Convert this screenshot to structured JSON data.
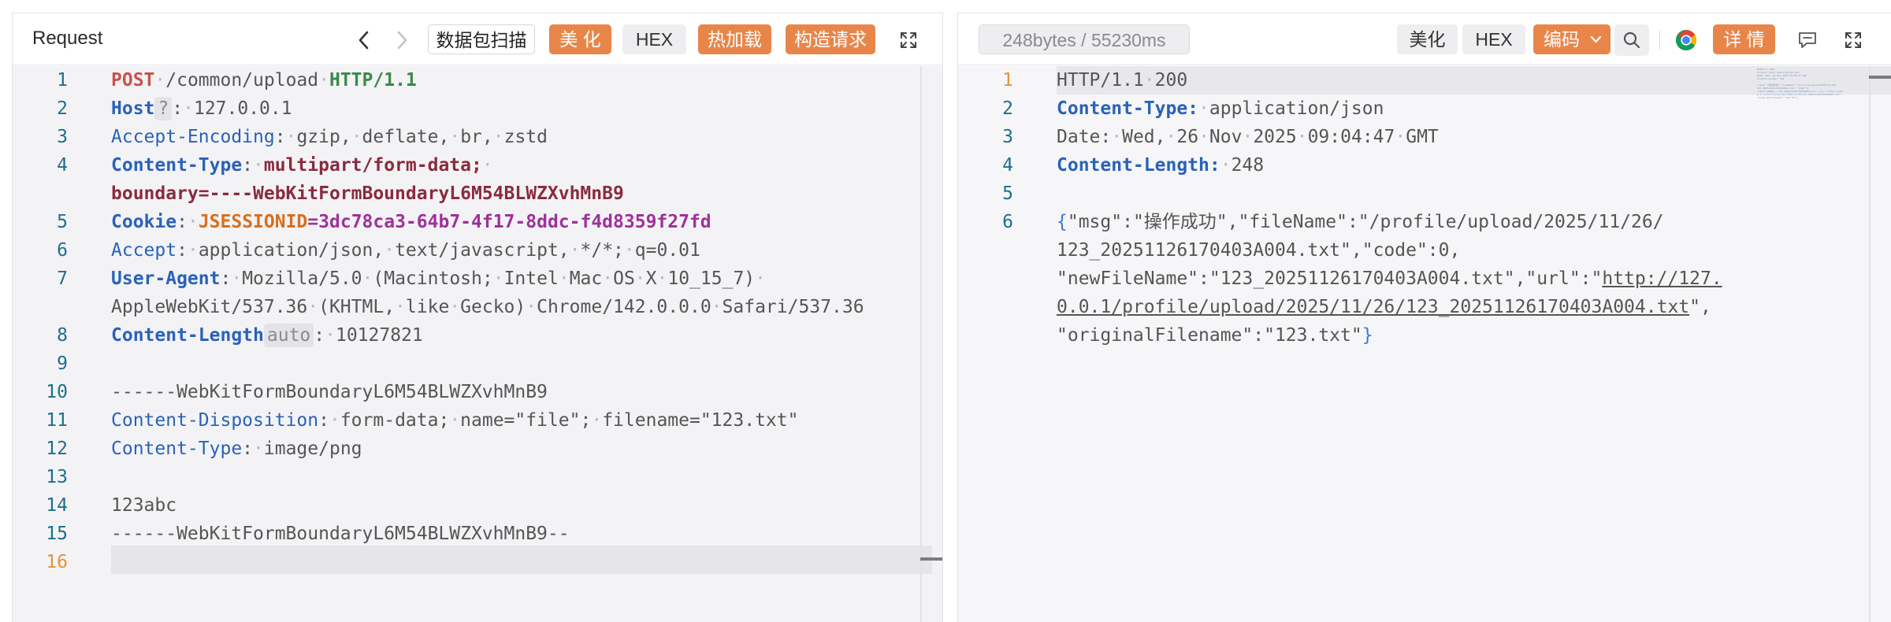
{
  "request": {
    "title": "Request",
    "toolbar": {
      "back_icon": "chevron-left-icon",
      "forward_icon": "chevron-right-icon",
      "scan_label": "数据包扫描",
      "beautify_label": "美 化",
      "hex_label": "HEX",
      "hotload_label": "热加载",
      "construct_label": "构造请求",
      "fullscreen_icon": "expand-icon"
    },
    "line_numbers": [
      "1",
      "2",
      "3",
      "4",
      "5",
      "6",
      "7",
      "8",
      "9",
      "10",
      "11",
      "12",
      "13",
      "14",
      "15",
      "16"
    ],
    "content": {
      "l1_method": "POST",
      "l1_path": "/common/upload",
      "l1_proto": "HTTP/1.1",
      "l2_key": "Host",
      "l2_badge": "?",
      "l2_val": "127.0.0.1",
      "l3_key": "Accept-Encoding",
      "l3_val_1": "gzip,",
      "l3_val_2": "deflate,",
      "l3_val_3": "br,",
      "l3_val_4": "zstd",
      "l4_key": "Content-Type",
      "l4_val": "multipart/form-data;",
      "l4_cont": "boundary=----WebKitFormBoundaryL6M54BLWZXvhMnB9",
      "l5_key": "Cookie",
      "l5_name": "JSESSIONID",
      "l5_eq": "=",
      "l5_val": "3dc78ca3-64b7-4f17-8ddc-f4d8359f27fd",
      "l6_key": "Accept",
      "l6_val_1": "application/json,",
      "l6_val_2": "text/javascript,",
      "l6_val_3": "*/*;",
      "l6_val_4": "q=0.01",
      "l7_key": "User-Agent",
      "l7_val_1": "Mozilla/5.0",
      "l7_val_2": "(Macintosh;",
      "l7_val_3": "Intel",
      "l7_val_4": "Mac",
      "l7_val_5": "OS",
      "l7_val_6": "X",
      "l7_val_7": "10_15_7)",
      "l7_cont_1": "AppleWebKit/537.36",
      "l7_cont_2": "(KHTML,",
      "l7_cont_3": "like",
      "l7_cont_4": "Gecko)",
      "l7_cont_5": "Chrome/142.0.0.0",
      "l7_cont_6": "Safari/537.36",
      "l8_key": "Content-Length",
      "l8_badge": "auto",
      "l8_val": "10127821",
      "l10": "------WebKitFormBoundaryL6M54BLWZXvhMnB9",
      "l11_key": "Content-Disposition",
      "l11_val_1": "form-data;",
      "l11_val_2": "name=\"file\";",
      "l11_val_3": "filename=\"123.txt\"",
      "l12_key": "Content-Type",
      "l12_val": "image/png",
      "l14": "123abc",
      "l15": "------WebKitFormBoundaryL6M54BLWZXvhMnB9--"
    }
  },
  "response": {
    "toolbar": {
      "stats": "248bytes / 55230ms",
      "beautify_label": "美化",
      "hex_label": "HEX",
      "encoding_label": "编码",
      "search_icon": "search-icon",
      "chrome_icon": "chrome-icon",
      "details_label": "详 情",
      "comment_icon": "comment-icon",
      "fullscreen_icon": "expand-icon"
    },
    "line_numbers": [
      "1",
      "2",
      "3",
      "4",
      "5",
      "6"
    ],
    "content": {
      "l1_proto": "HTTP/1.1",
      "l1_status": "200",
      "l2_key": "Content-Type:",
      "l2_val": "application/json",
      "l3_key": "Date:",
      "l3_val_1": "Wed,",
      "l3_val_2": "26",
      "l3_val_3": "Nov",
      "l3_val_4": "2025",
      "l3_val_5": "09:04:47",
      "l3_val_6": "GMT",
      "l4_key": "Content-Length:",
      "l4_val": "248",
      "l6_brace_open": "{",
      "l6_part1": "\"msg\":\"操作成功\",\"fileName\":\"/profile/upload/2025/11/26/",
      "l6_part2": "123_20251126170403A004.txt\",\"code\":0,",
      "l6_part3a": "\"newFileName\":\"123_20251126170403A004.txt\",\"url\":\"",
      "l6_part3b": "http://127.",
      "l6_part4a": "0.0.1/profile/upload/2025/11/26/123_20251126170403A004.txt",
      "l6_part4b": "\",",
      "l6_part5": "\"originalFilename\":\"123.txt\"",
      "l6_brace_close": "}"
    }
  }
}
